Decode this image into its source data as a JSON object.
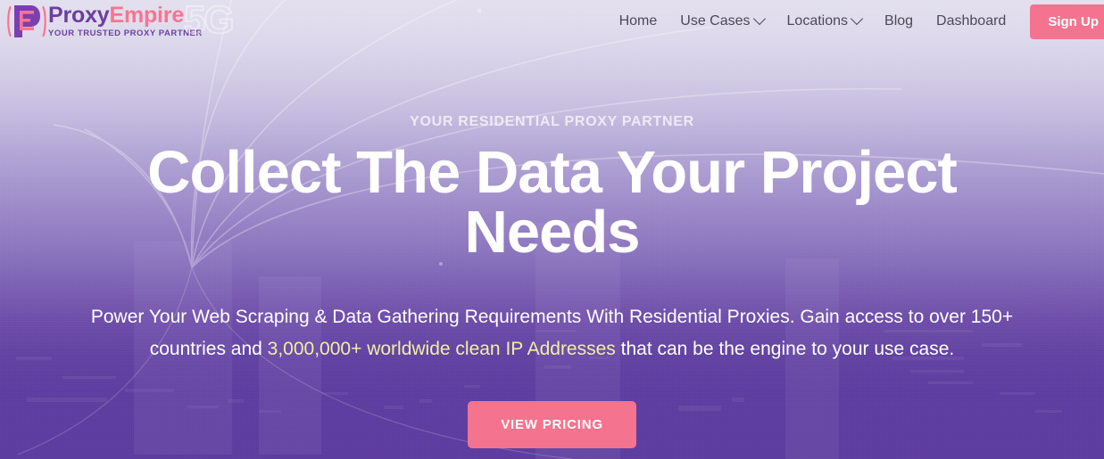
{
  "brand": {
    "name_part1": "Proxy",
    "name_part2": "Empire",
    "tagline": "YOUR TRUSTED PROXY PARTNER",
    "watermark": "5G",
    "logo_icon": "proxyempire-pe-monogram-icon",
    "colors": {
      "purple": "#6b3fa0",
      "pink": "#fa7490"
    }
  },
  "nav": {
    "items": [
      {
        "label": "Home",
        "has_dropdown": false
      },
      {
        "label": "Use Cases",
        "has_dropdown": true
      },
      {
        "label": "Locations",
        "has_dropdown": true
      },
      {
        "label": "Blog",
        "has_dropdown": false
      },
      {
        "label": "Dashboard",
        "has_dropdown": false
      }
    ],
    "signup_label": "Sign Up",
    "text_color": "#4a4a55",
    "signup_color": "#f4738e"
  },
  "hero": {
    "eyebrow": "YOUR RESIDENTIAL PROXY PARTNER",
    "headline": "Collect The Data Your Project Needs",
    "subtitle_before": "Power Your Web Scraping & Data Gathering Requirements With Residential Proxies. Gain access to over 150+ countries and ",
    "subtitle_highlight": "3,000,000+ worldwide clean IP Addresses",
    "subtitle_after": " that can be the engine to your use case.",
    "cta_label": "VIEW PRICING",
    "highlight_color": "#f1efa2",
    "cta_color": "#f4738e",
    "background_top_color": "#e2dfee",
    "background_bottom_color": "#5b3a9e"
  }
}
